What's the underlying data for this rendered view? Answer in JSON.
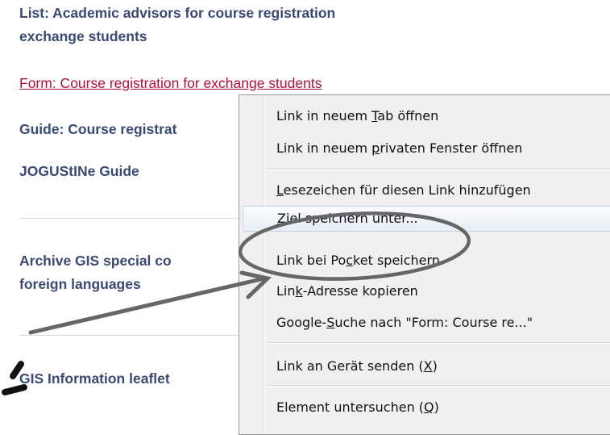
{
  "page": {
    "links": [
      {
        "id": "list",
        "line1": "List: Academic advisors for course registration",
        "line2": "exchange students"
      },
      {
        "id": "form",
        "text": "Form: Course registration for exchange students"
      },
      {
        "id": "guide",
        "text": "Guide: Course registrat"
      },
      {
        "id": "jogu",
        "text": "JOGUStINe Guide"
      },
      {
        "id": "archive",
        "line1": "Archive GIS special co",
        "line2": "foreign languages"
      },
      {
        "id": "leaflet",
        "text": "GIS Information leaflet"
      }
    ]
  },
  "context_menu": {
    "items": [
      {
        "pre": "Link in neuem ",
        "key": "T",
        "post": "ab öffnen"
      },
      {
        "pre": "Link in neuem ",
        "key": "p",
        "post": "rivaten Fenster öffnen"
      },
      {
        "pre": "",
        "key": "L",
        "post": "esezeichen für diesen Link hinzufügen"
      },
      {
        "pre": "",
        "key": "Z",
        "post": "iel speichern unter..."
      },
      {
        "pre": "Link bei Po",
        "key": "c",
        "post": "ket speichern"
      },
      {
        "pre": "Lin",
        "key": "k",
        "post": "-Adresse kopieren"
      },
      {
        "pre": "Google-",
        "key": "S",
        "post": "uche nach \"Form: Course re...\""
      },
      {
        "pre": "Link an Gerät senden (",
        "key": "X",
        "post": ")"
      },
      {
        "pre": "Element untersuchen (",
        "key": "Q",
        "post": ")"
      }
    ],
    "highlighted_item": "Ziel speichern unter..."
  },
  "annotations": {
    "circle_target": "Link bei Pocket speichern",
    "ink_color": "#666666",
    "mark_color": "#111111"
  }
}
